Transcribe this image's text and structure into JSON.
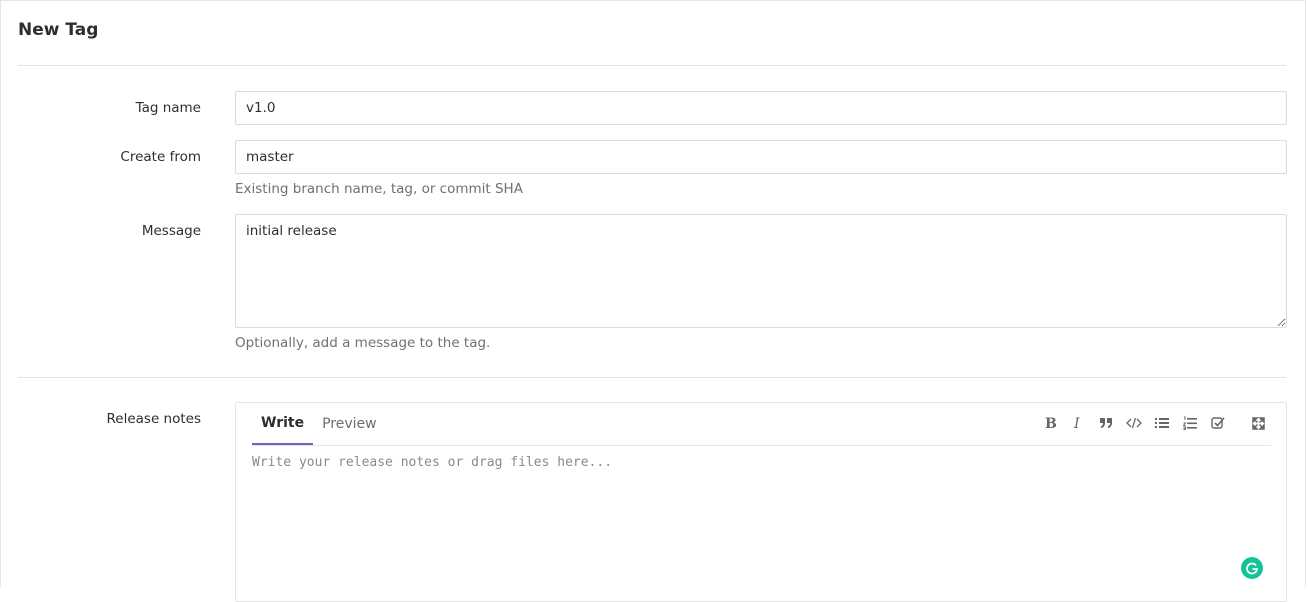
{
  "page": {
    "title": "New Tag"
  },
  "form": {
    "tag_name": {
      "label": "Tag name",
      "value": "v1.0"
    },
    "create_from": {
      "label": "Create from",
      "value": "master",
      "help": "Existing branch name, tag, or commit SHA"
    },
    "message": {
      "label": "Message",
      "value": "initial release",
      "help": "Optionally, add a message to the tag."
    },
    "release_notes": {
      "label": "Release notes",
      "tabs": [
        {
          "label": "Write",
          "active": true
        },
        {
          "label": "Preview",
          "active": false
        }
      ],
      "placeholder": "Write your release notes or drag files here...",
      "toolbar": [
        "bold-icon",
        "italic-icon",
        "quote-icon",
        "code-icon",
        "bullet-list-icon",
        "numbered-list-icon",
        "task-list-icon",
        "fullscreen-icon"
      ]
    }
  },
  "colors": {
    "active_tab_underline": "#6666c4",
    "grammarly": "#15c39a"
  }
}
